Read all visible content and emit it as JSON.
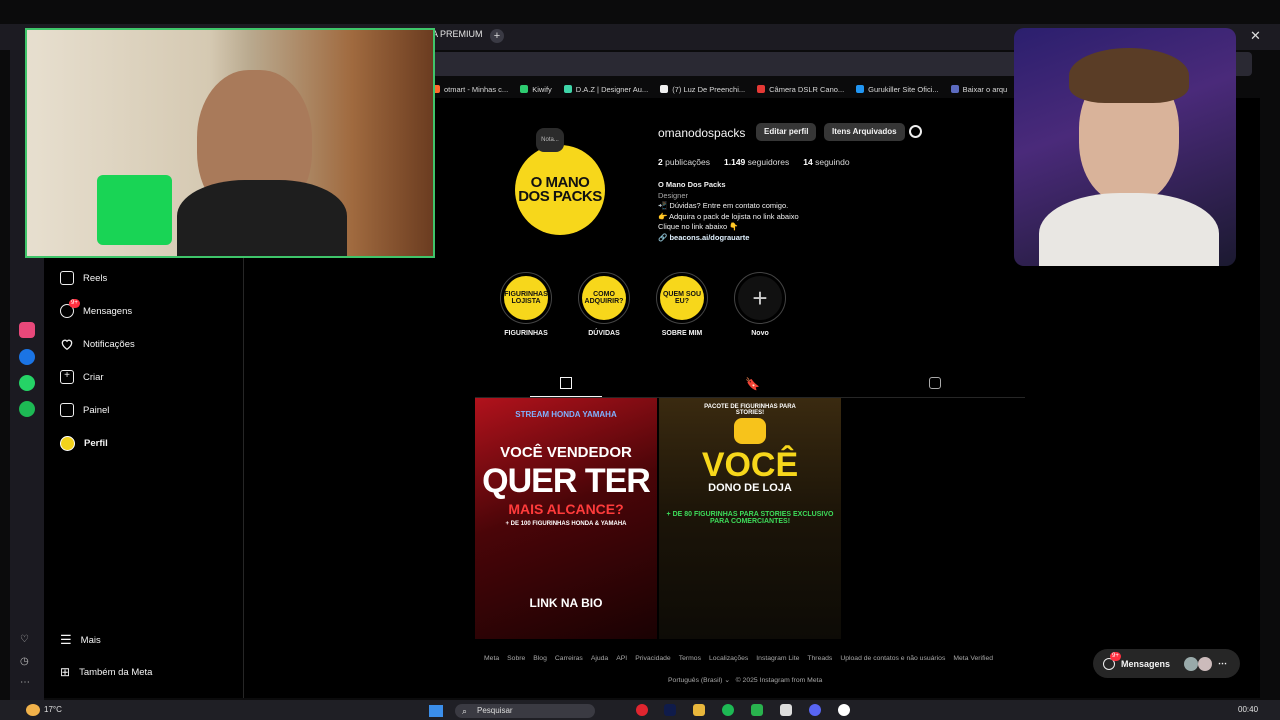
{
  "browser": {
    "tab_label": "A PREMIUM",
    "new_tab": "+",
    "close": "✕",
    "bookmarks": [
      {
        "label": "otmart - Minhas c...",
        "color": "#ff6a2b"
      },
      {
        "label": "Kiwify",
        "color": "#2ecc71"
      },
      {
        "label": "D.A.Z | Designer Au...",
        "color": "#3fd4a8"
      },
      {
        "label": "(7) Luz De Preenchi...",
        "color": "#f0f0f0"
      },
      {
        "label": "Câmera DSLR Cano...",
        "color": "#e53935"
      },
      {
        "label": "Gurukiller Site Ofici...",
        "color": "#2196f3"
      },
      {
        "label": "Baixar o arqu",
        "color": "#5c6bc0"
      }
    ]
  },
  "nav": {
    "items": [
      {
        "label": "Reels"
      },
      {
        "label": "Mensagens",
        "badge": "9+"
      },
      {
        "label": "Notificações"
      },
      {
        "label": "Criar"
      },
      {
        "label": "Painel"
      },
      {
        "label": "Perfil"
      }
    ],
    "mais": "Mais",
    "meta": "Também da Meta"
  },
  "profile": {
    "avatar_text": "O MANO DOS PACKS",
    "note": "Nota...",
    "username": "omanodospacks",
    "edit_button": "Editar perfil",
    "archive_button": "Itens Arquivados",
    "posts_count": "2",
    "posts_label": "publicações",
    "followers_count": "1.149",
    "followers_label": "seguidores",
    "following_count": "14",
    "following_label": "seguindo",
    "name": "O Mano Dos Packs",
    "category": "Designer",
    "bio_lines": [
      "📲 Dúvidas? Entre em contato comigo.",
      "👉 Adquira o pack de lojista no link abaixo",
      "Clique no link abaixo 👇"
    ],
    "link": "beacons.ai/dograuarte"
  },
  "highlights": [
    {
      "inner": "FIGURINHAS LOJISTA",
      "label": "FIGURINHAS"
    },
    {
      "inner": "COMO ADQUIRIR?",
      "label": "DÚVIDAS"
    },
    {
      "inner": "QUEM SOU EU?",
      "label": "SOBRE MIM"
    },
    {
      "inner": "+",
      "label": "Novo"
    }
  ],
  "posts": [
    {
      "top": "STREAM HONDA YAMAHA",
      "headline": "VOCÊ VENDEDOR",
      "big": "QUER TER",
      "accent": "MAIS ALCANCE?",
      "sub": "+ DE 100 FIGURINHAS HONDA & YAMAHA",
      "cta": "LINK NA BIO"
    },
    {
      "top": "PACOTE DE FIGURINHAS PARA STORIES!",
      "big": "VOCÊ",
      "accent": "DONO DE LOJA",
      "sub": "+ DE 80 FIGURINHAS PARA STORIES EXCLUSIVO PARA COMERCIANTES!"
    }
  ],
  "footer": {
    "links": [
      "Meta",
      "Sobre",
      "Blog",
      "Carreiras",
      "Ajuda",
      "API",
      "Privacidade",
      "Termos",
      "Localizações",
      "Instagram Lite",
      "Threads",
      "Upload de contatos e não usuários",
      "Meta Verified"
    ],
    "language": "Português (Brasil)",
    "copyright": "© 2025 Instagram from Meta"
  },
  "messages_pill": {
    "label": "Mensagens",
    "badge": "9+"
  },
  "taskbar": {
    "temperature": "17°C",
    "search": "Pesquisar",
    "time": "00:40"
  },
  "colors": {
    "accent_yellow": "#f7d71b",
    "ig_bg": "#000000",
    "badge_red": "#ff3040"
  }
}
